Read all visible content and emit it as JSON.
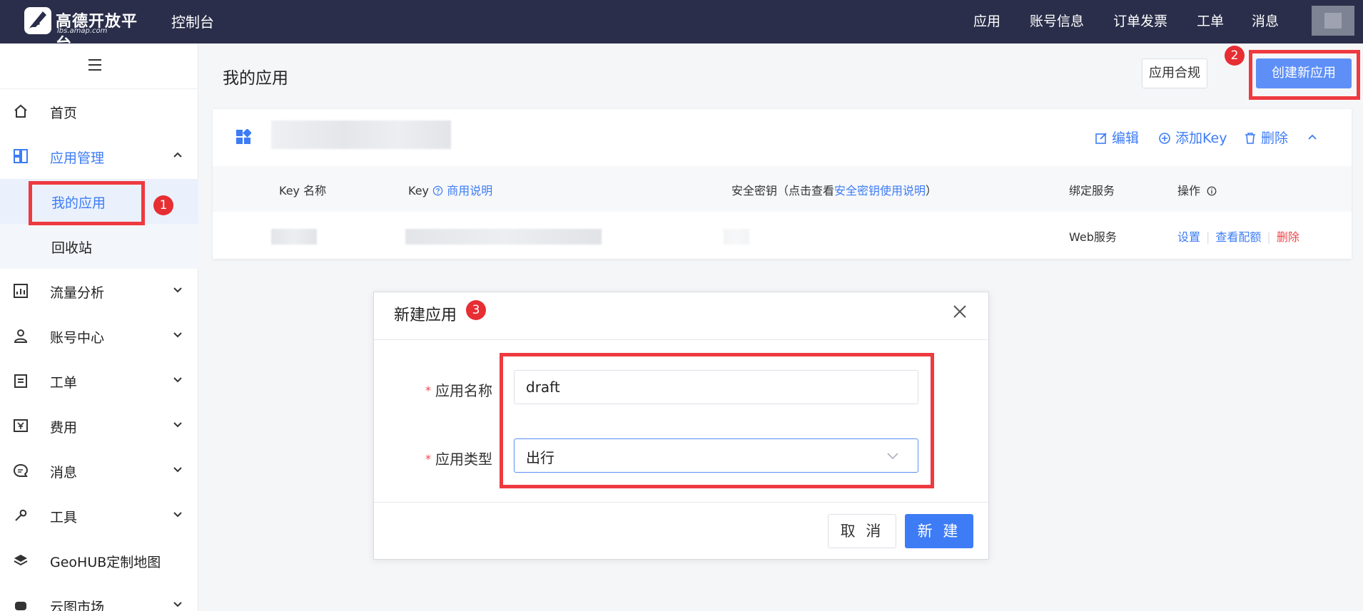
{
  "topbar": {
    "logo_text": "高德开放平台",
    "logo_sub": "lbs.amap.com",
    "console": "控制台",
    "nav": [
      "应用",
      "账号信息",
      "订单发票",
      "工单",
      "消息"
    ]
  },
  "sidebar": {
    "items": [
      {
        "label": "首页",
        "icon": "home-icon"
      },
      {
        "label": "应用管理",
        "icon": "grid-icon"
      },
      {
        "label": "我的应用"
      },
      {
        "label": "回收站"
      },
      {
        "label": "流量分析",
        "icon": "chart-icon"
      },
      {
        "label": "账号中心",
        "icon": "user-icon"
      },
      {
        "label": "工单",
        "icon": "clipboard-icon"
      },
      {
        "label": "费用",
        "icon": "yen-icon"
      },
      {
        "label": "消息",
        "icon": "message-icon"
      },
      {
        "label": "工具",
        "icon": "wrench-icon"
      },
      {
        "label": "GeoHUB定制地图",
        "icon": "layers-icon"
      },
      {
        "label": "云图市场",
        "icon": "cloud-icon"
      }
    ]
  },
  "main": {
    "title": "我的应用",
    "compliance_btn": "应用合规",
    "create_btn": "创建新应用",
    "card": {
      "edit": "编辑",
      "add_key": "添加Key",
      "delete": "删除"
    },
    "table": {
      "headers": {
        "key_name": "Key 名称",
        "key": "Key",
        "commercial_note": "商用说明",
        "secret_prefix": "安全密钥（点击查看",
        "secret_link": "安全密钥使用说明",
        "secret_suffix": "）",
        "service": "绑定服务",
        "ops": "操作"
      },
      "row": {
        "service": "Web服务",
        "ops": [
          "设置",
          "查看配额",
          "删除"
        ]
      }
    }
  },
  "dialog": {
    "title": "新建应用",
    "name_label": "应用名称",
    "name_value": "draft",
    "type_label": "应用类型",
    "type_value": "出行",
    "cancel": "取 消",
    "confirm": "新 建"
  },
  "annotations": {
    "badge1": "1",
    "badge2": "2",
    "badge3": "3"
  },
  "colors": {
    "topbar": "#2a2e4a",
    "accent": "#3d7cf5",
    "highlight": "#ee3a3f"
  }
}
